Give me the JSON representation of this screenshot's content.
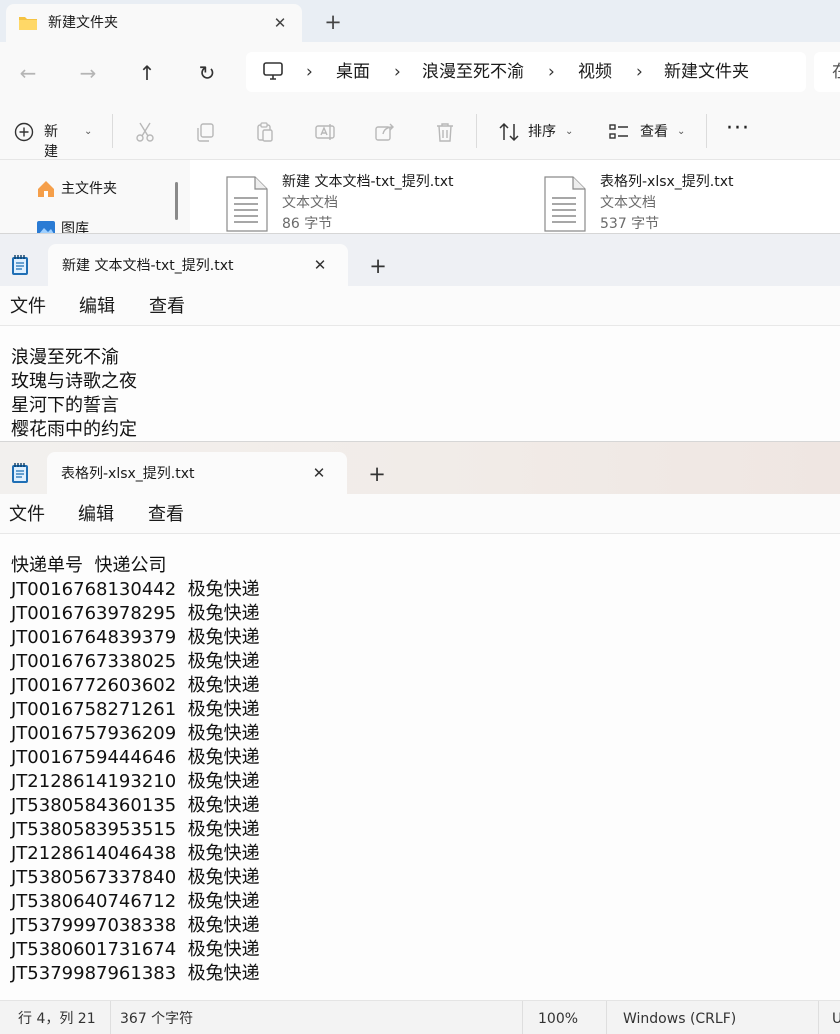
{
  "explorer": {
    "tab_title": "新建文件夹",
    "breadcrumb": [
      "桌面",
      "浪漫至死不渝",
      "视频",
      "新建文件夹"
    ],
    "search_partial": "在",
    "toolbar": {
      "new_label": "新建",
      "sort_label": "排序",
      "view_label": "查看"
    },
    "sidebar": {
      "home": "主文件夹",
      "pictures": "图库"
    },
    "files": [
      {
        "name": "新建 文本文档-txt_提列.txt",
        "type": "文本文档",
        "size": "86 字节"
      },
      {
        "name": "表格列-xlsx_提列.txt",
        "type": "文本文档",
        "size": "537 字节"
      }
    ]
  },
  "notepad1": {
    "tab_title": "新建 文本文档-txt_提列.txt",
    "menu": [
      "文件",
      "编辑",
      "查看"
    ],
    "lines": [
      "浪漫至死不渝",
      "玫瑰与诗歌之夜",
      "星河下的誓言",
      "樱花雨中的约定"
    ]
  },
  "notepad2": {
    "tab_title": "表格列-xlsx_提列.txt",
    "menu": [
      "文件",
      "编辑",
      "查看"
    ],
    "header": "快递单号  快递公司",
    "rows": [
      {
        "id": "JT0016768130442",
        "company": "极兔快递"
      },
      {
        "id": "JT0016763978295",
        "company": "极兔快递"
      },
      {
        "id": "JT0016764839379",
        "company": "极兔快递"
      },
      {
        "id": "JT0016767338025",
        "company": "极兔快递"
      },
      {
        "id": "JT0016772603602",
        "company": "极兔快递"
      },
      {
        "id": "JT0016758271261",
        "company": "极兔快递"
      },
      {
        "id": "JT0016757936209",
        "company": "极兔快递"
      },
      {
        "id": "JT0016759444646",
        "company": "极兔快递"
      },
      {
        "id": "JT2128614193210",
        "company": "极兔快递"
      },
      {
        "id": "JT5380584360135",
        "company": "极兔快递"
      },
      {
        "id": "JT5380583953515",
        "company": "极兔快递"
      },
      {
        "id": "JT2128614046438",
        "company": "极兔快递"
      },
      {
        "id": "JT5380567337840",
        "company": "极兔快递"
      },
      {
        "id": "JT5380640746712",
        "company": "极兔快递"
      },
      {
        "id": "JT5379997038338",
        "company": "极兔快递"
      },
      {
        "id": "JT5380601731674",
        "company": "极兔快递"
      },
      {
        "id": "JT5379987961383",
        "company": "极兔快递"
      }
    ],
    "status": {
      "position": "行 4，列 21",
      "chars": "367 个字符",
      "zoom": "100%",
      "line_ending": "Windows (CRLF)",
      "encoding_partial": "U"
    }
  },
  "colors": {
    "accent": "#0067c0",
    "folder": "#f5c342",
    "notepad_icon": "#1f6fb5"
  }
}
